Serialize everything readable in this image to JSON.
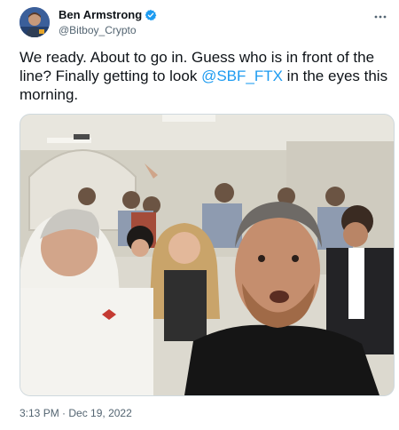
{
  "author": {
    "display_name": "Ben Armstrong",
    "handle": "@Bitboy_Crypto",
    "verified": true,
    "avatar_icon": "user-avatar"
  },
  "tweet": {
    "text_before": "We ready. About to go in. Guess who is in front of the line? Finally getting to look ",
    "mention": "@SBF_FTX",
    "text_after": " in the eyes this morning.",
    "media_alt": "Selfie of a man in a crowded room of people waiting in line"
  },
  "meta": {
    "time": "3:13 PM",
    "separator": " · ",
    "date": "Dec 19, 2022"
  },
  "icons": {
    "more": "more-horizontal-icon",
    "verified": "verified-badge-icon"
  },
  "colors": {
    "accent": "#1d9bf0",
    "text": "#0f1419",
    "secondary": "#536471"
  }
}
